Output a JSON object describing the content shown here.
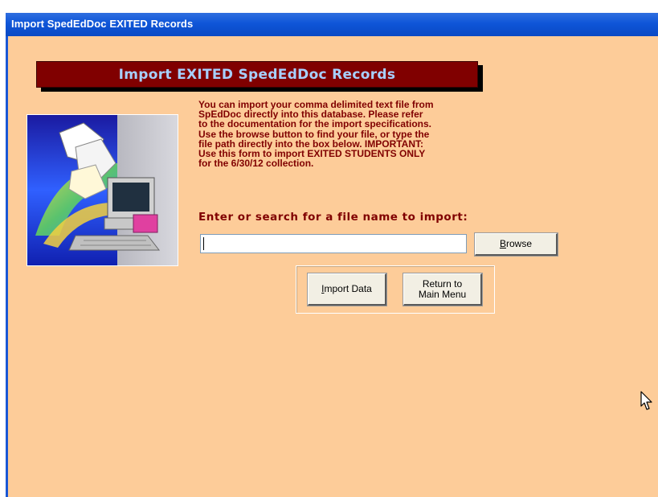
{
  "window": {
    "title": "Import SpedEdDoc EXITED Records"
  },
  "banner": {
    "title": "Import EXITED SpedEdDoc Records"
  },
  "instructions": {
    "text": "You can import your comma delimited text file from\nSpEdDoc directly into this database.  Please refer\nto the documentation for the import specifications.\nUse the browse button to find your file, or type the\nfile path directly into the box below.  IMPORTANT:\nUse this form to import EXITED STUDENTS ONLY\nfor the 6/30/12 collection."
  },
  "file_prompt": {
    "label": "Enter or search for a file name to import:",
    "value": ""
  },
  "buttons": {
    "browse": {
      "mnemonic": "B",
      "rest": "rowse"
    },
    "import_data": {
      "mnemonic": "I",
      "rest": "mport Data"
    },
    "return_line1": "Return to",
    "return_line2": "Main Menu"
  },
  "colors": {
    "form_background": "#fdcc99",
    "banner_background": "#800000",
    "banner_text": "#a7d0ff",
    "label_text": "#800000",
    "titlebar": "#0e55d8"
  },
  "icons": {
    "illustration": "computer-documents-illustration",
    "cursor": "mouse-pointer-icon"
  }
}
